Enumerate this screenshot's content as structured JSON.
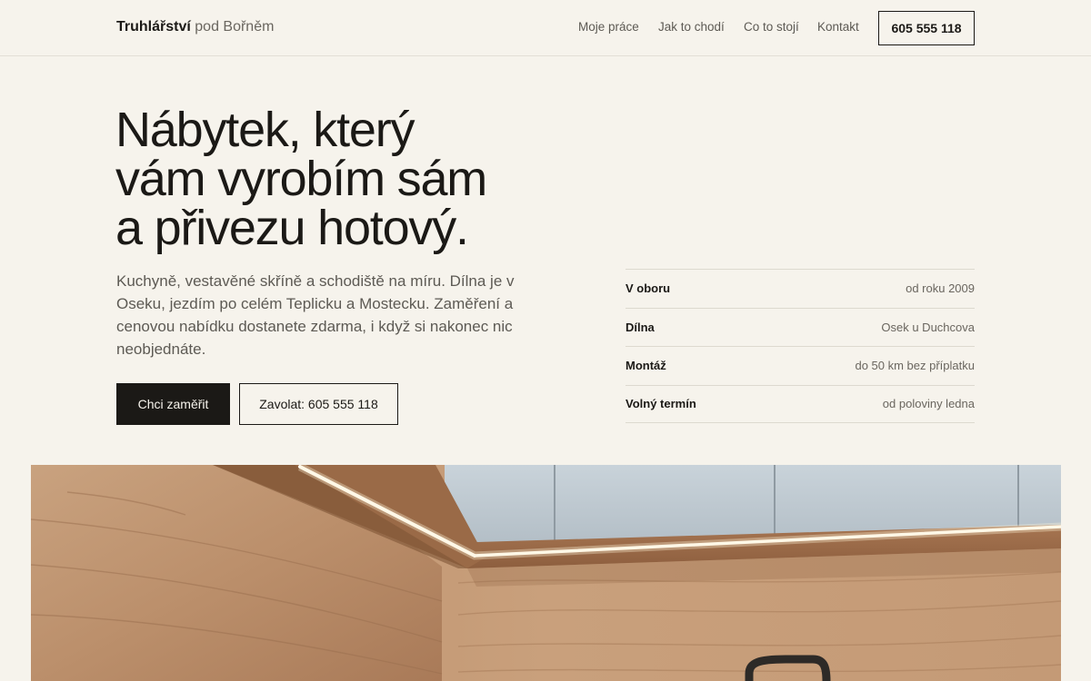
{
  "header": {
    "brand_bold": "Truhlářství",
    "brand_light": "pod Bořněm",
    "nav": [
      "Moje práce",
      "Jak to chodí",
      "Co to stojí",
      "Kontakt"
    ],
    "phone": "605 555 118"
  },
  "hero": {
    "title_lines": [
      "Nábytek, který",
      "vám vyrobím sám",
      "a přivezu hotový."
    ],
    "text": "Kuchyně, vestavěné skříně a schodiště na míru. Dílna je v Oseku, jezdím po celém Teplicku a Mostecku. Zaměření a cenovou nabídku dostanete zdarma, i když si nakonec nic neobjednáte.",
    "primary_button": "Chci zaměřit",
    "secondary_button": "Zavolat: 605 555 118"
  },
  "facts": [
    {
      "label": "V oboru",
      "value": "od roku 2009"
    },
    {
      "label": "Dílna",
      "value": "Osek u Duchcova"
    },
    {
      "label": "Montáž",
      "value": "do 50 km bez příplatku"
    },
    {
      "label": "Volný termín",
      "value": "od poloviny ledna"
    }
  ]
}
